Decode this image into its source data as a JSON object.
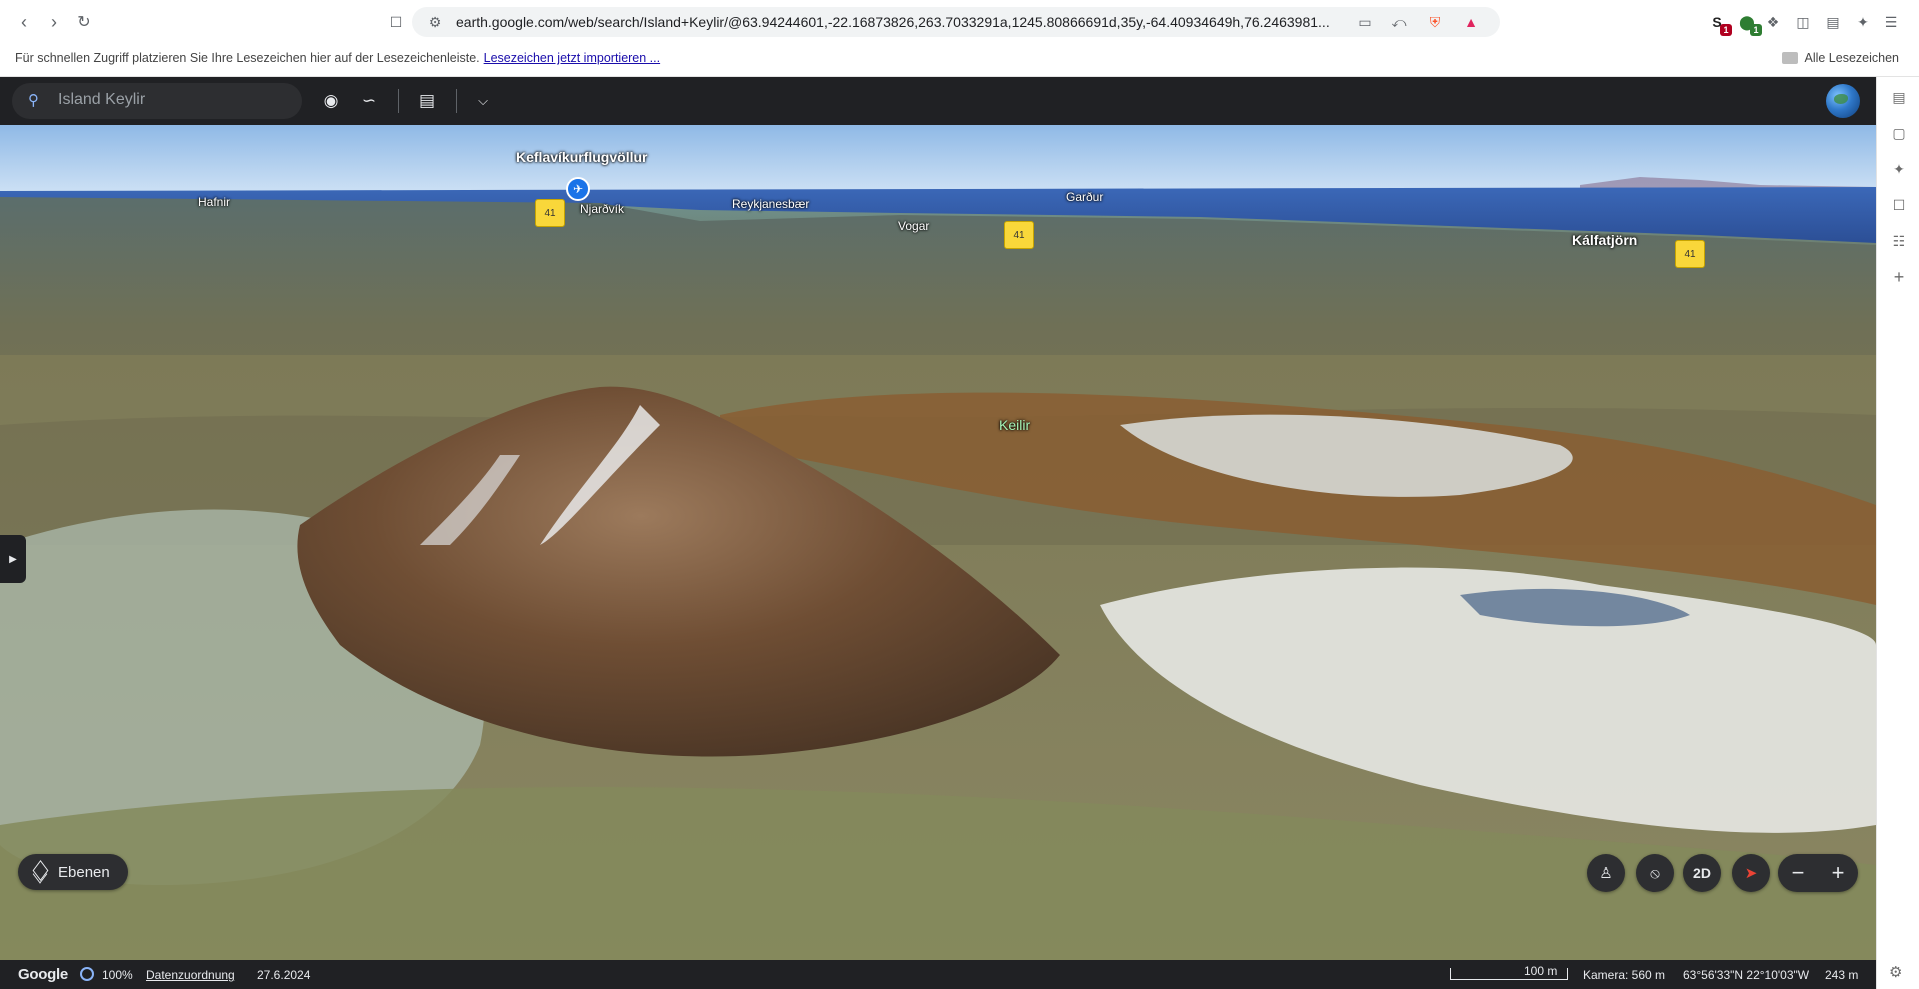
{
  "browser": {
    "url": "earth.google.com/web/search/Island+Keylir/@63.94244601,-22.16873826,263.7033291a,1245.80866691d,35y,-64.40934649h,76.2463981...",
    "extensions": [
      {
        "name": "s-extension-icon",
        "badge": "1",
        "badge_color": "#b00020"
      },
      {
        "name": "shield-extension-icon",
        "badge": "1",
        "badge_color": "#2e7d32"
      }
    ]
  },
  "bookmarks": {
    "hint": "Für schnellen Zugriff platzieren Sie Ihre Lesezeichen hier auf der Lesezeichenleiste.",
    "import_link": "Lesezeichen jetzt importieren ...",
    "all_bookmarks": "Alle Lesezeichen"
  },
  "earth": {
    "search": {
      "placeholder": "Island Keylir"
    },
    "places": [
      {
        "label": "Keflavíkurflugvöllur",
        "style": "big"
      },
      {
        "label": "Hafnir",
        "style": "normal"
      },
      {
        "label": "Njarðvík",
        "style": "normal"
      },
      {
        "label": "Reykjanesbær",
        "style": "normal"
      },
      {
        "label": "Vogar",
        "style": "normal"
      },
      {
        "label": "Garður",
        "style": "normal"
      },
      {
        "label": "Kálfatjörn",
        "style": "big"
      },
      {
        "label": "Keilir",
        "style": "green"
      }
    ],
    "road_badges": [
      "41",
      "41",
      "41"
    ],
    "layers_label": "Ebenen",
    "view_mode_label": "2D",
    "status": {
      "logo": "Google",
      "load_percent": "100%",
      "attribution_link": "Datenzuordnung",
      "date": "27.6.2024",
      "scale": "100 m",
      "camera": "Kamera: 560 m",
      "coordinates": "63°56'33\"N 22°10'03\"W",
      "elevation": "243 m"
    },
    "colors": {
      "toolbar_bg": "#202124",
      "accent": "#1a73e8",
      "road_badge": "#f9d73a"
    }
  }
}
